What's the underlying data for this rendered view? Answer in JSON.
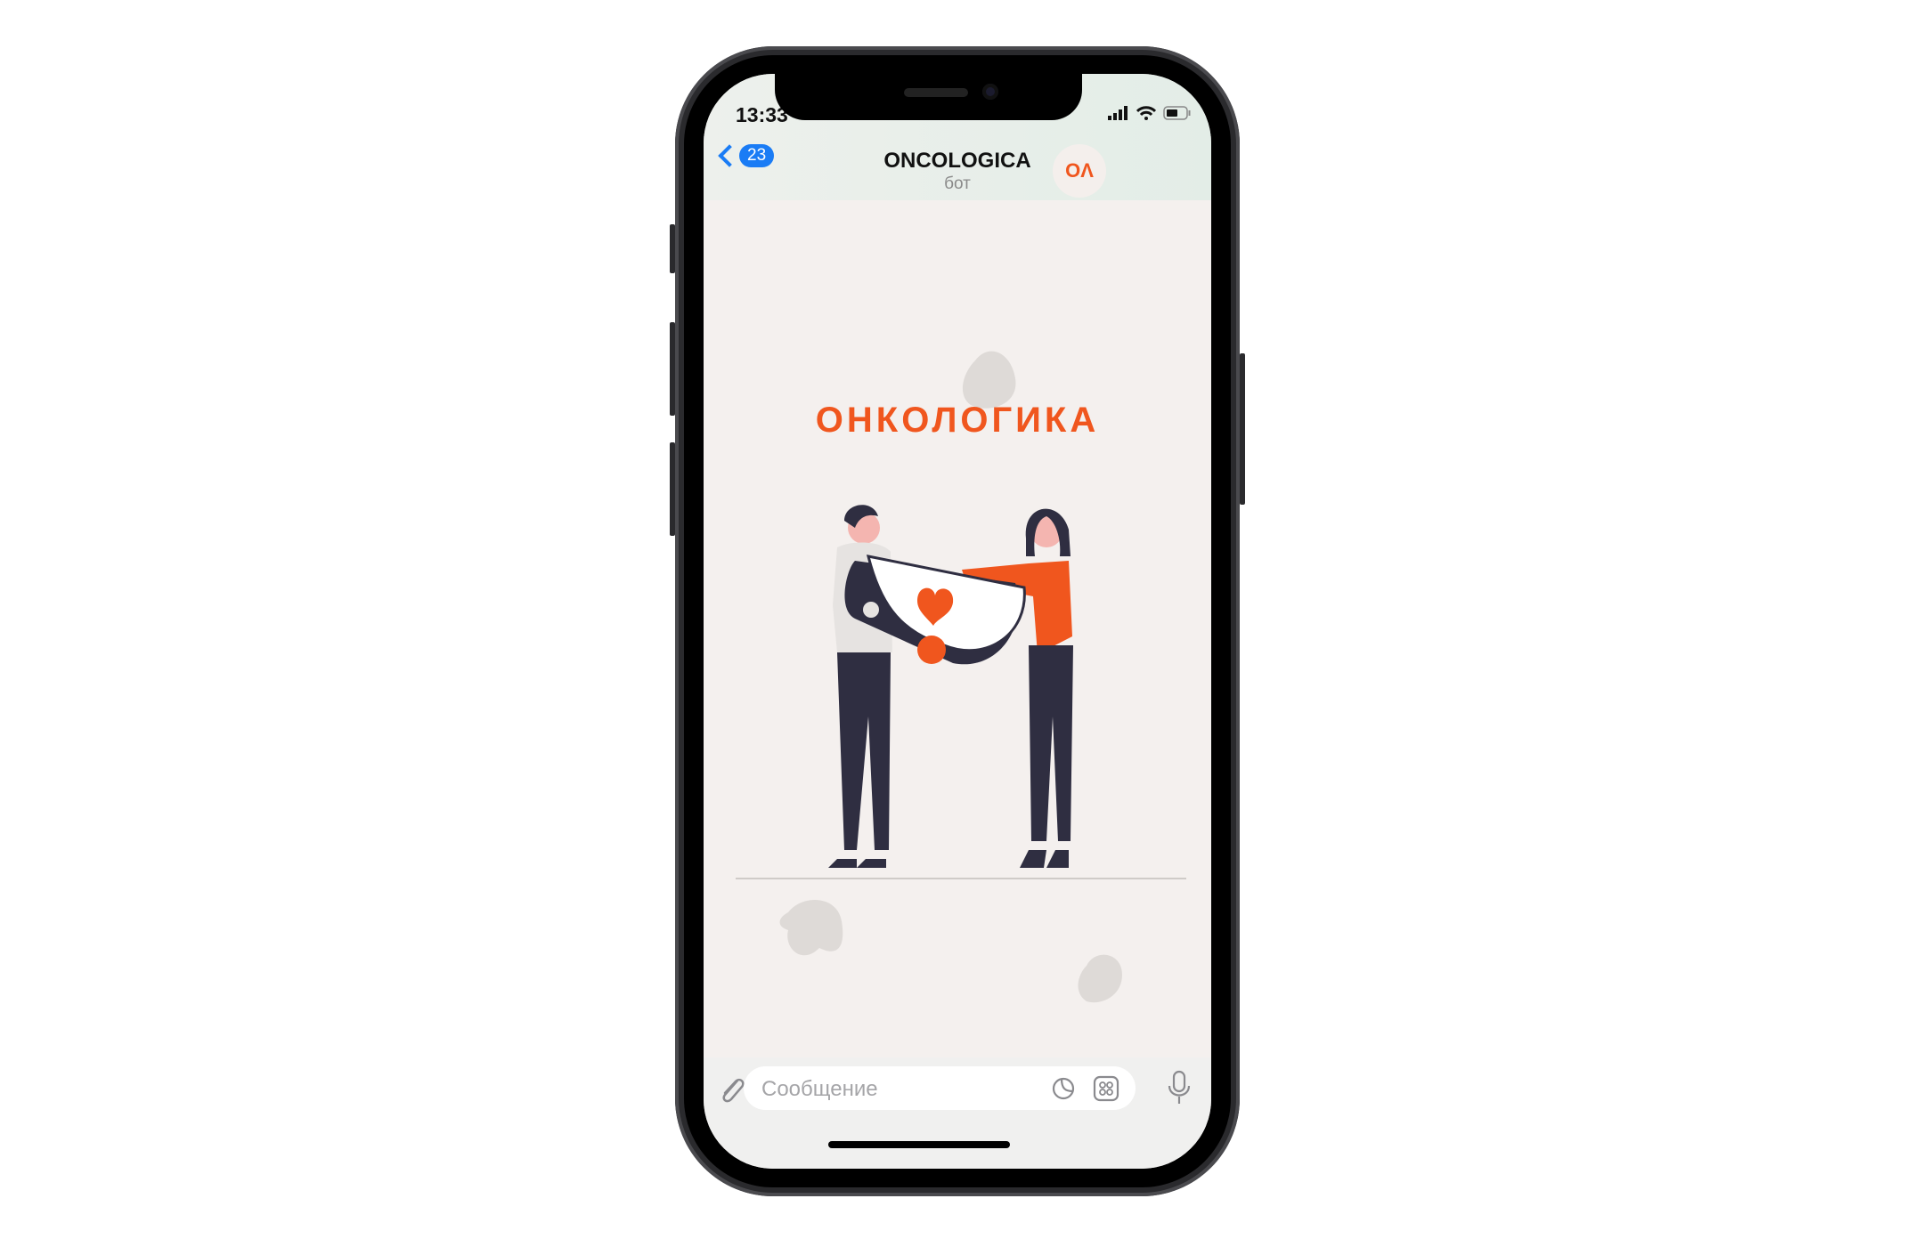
{
  "status_bar": {
    "time": "13:33"
  },
  "header": {
    "back_count": "23",
    "title": "ONCOLOGICA",
    "subtitle": "бот",
    "avatar_text": "ОΛ"
  },
  "chat": {
    "logo_text": "ОНКОЛОГИКА"
  },
  "composer": {
    "placeholder": "Сообщение"
  },
  "colors": {
    "accent": "#1a7cf5",
    "brand": "#f0561e",
    "figure_dark": "#2f2e41"
  }
}
